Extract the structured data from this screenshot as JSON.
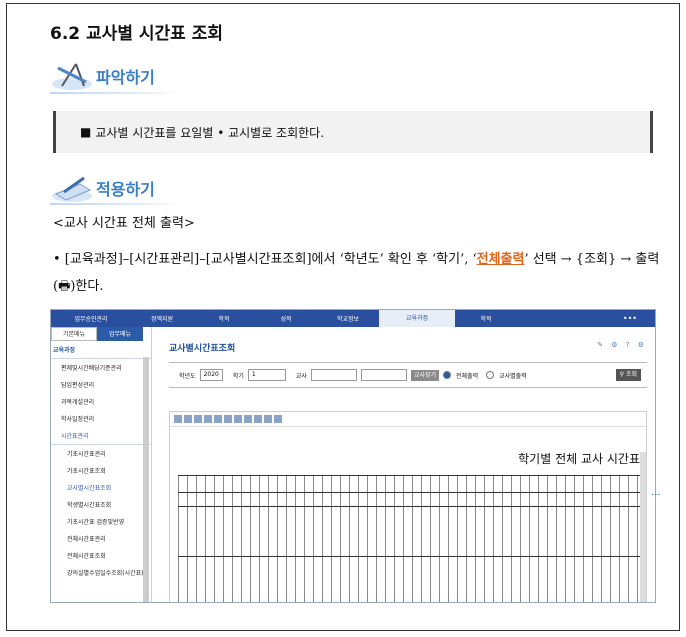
{
  "section_title": "6.2 교사별 시간표 조회",
  "understand": {
    "label": "파악하기",
    "summary": "교사별 시간표를 요일별 • 교시별로 조회한다."
  },
  "apply": {
    "label": "적용하기",
    "subtitle": "<교사 시간표 전체 출력>",
    "bullet_part1": "• [교육과정]–[시간표관리]–[교사별시간표조회]에서 ‘학년도’ 확인 후 ‘학기’, ‘",
    "bullet_highlight": "전체출력",
    "bullet_part2": "’ 선택 → {조회} → 출력(",
    "bullet_end": ")한다."
  },
  "app": {
    "nav": [
      "업무승인관리",
      "정액지원",
      "학적",
      "성적",
      "학교정보",
      "교육과정",
      "학적"
    ],
    "nav_active_index": 5,
    "nav_more": "•••",
    "tabs": [
      "기본메뉴",
      "업무메뉴"
    ],
    "group": "교육과정",
    "menu_items": [
      "편제및시간배당기준관리",
      "담임편성관리",
      "과목개설관리",
      "학사일정관리"
    ],
    "section": "시간표관리",
    "sub_items": [
      "기초시간표관리",
      "기초시간표조회",
      "교사별시간표조회",
      "학생별시간표조회",
      "기초시간표 검증및반영",
      "전체시간표관리",
      "전체시간표조회",
      "강의실별수업일수조회(시간표)"
    ],
    "sub_active_index": 2,
    "page_title": "교사별시간표조회",
    "filter": {
      "year_label": "학년도",
      "year_value": "2020",
      "term_label": "학기",
      "term_value": "1",
      "teacher_label": "교사",
      "find_button": "교사찾기",
      "radio_all": "전체출력",
      "radio_teacher": "교사별출력",
      "search_button": "조회"
    },
    "report_title": "학기별 전체 교사 시간표"
  },
  "colors": {
    "accent": "#2a4f9e",
    "highlight": "#e2661a"
  }
}
